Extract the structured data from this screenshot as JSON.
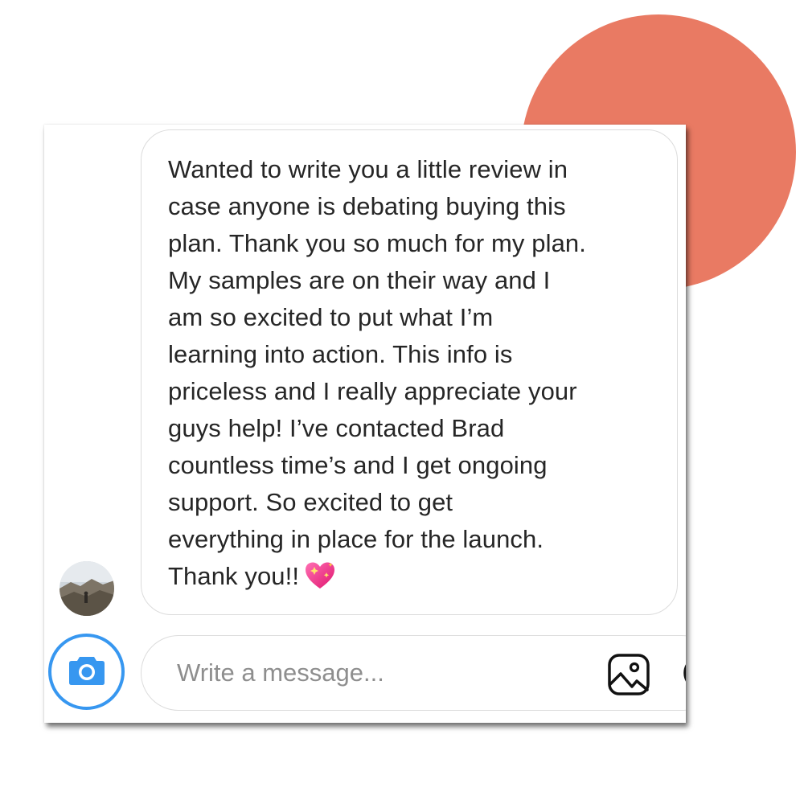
{
  "message": {
    "text": "Wanted to write you a little review in\ncase anyone is debating buying this\nplan. Thank you so much for my plan.\nMy samples are on their way and I\nam so excited to put what I’m\nlearning into action. This info is\npriceless and I really appreciate your\nguys help! I’ve contacted Brad\ncountless time’s and I get ongoing\nsupport. So excited to get\neverything in place for the launch.\nThank you!!",
    "emoji_icon": "sparkling-heart-icon"
  },
  "composer": {
    "placeholder": "Write a message...",
    "camera_icon": "camera-icon",
    "gallery_icon": "image-gallery-icon",
    "sticker_icon": "sticker-icon"
  },
  "sender": {
    "avatar_icon": "profile-photo-landscape"
  },
  "colors": {
    "accent_blue": "#3797f0",
    "decor_circle": "#e97a63",
    "bubble_border": "#dcdcdc",
    "text": "#262626",
    "placeholder": "#8e8e8e"
  }
}
